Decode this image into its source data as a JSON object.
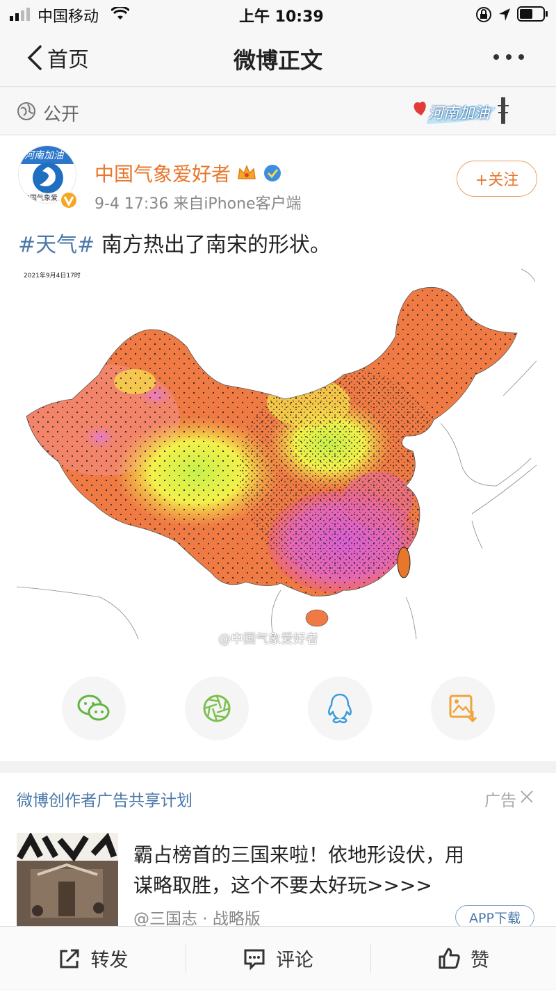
{
  "status_bar": {
    "carrier": "中国移动",
    "time": "上午 10:39"
  },
  "nav": {
    "back_label": "首页",
    "title": "微博正文",
    "more_icon": "more-dots-icon"
  },
  "visibility": {
    "label": "公开",
    "badge_text": "河南加油"
  },
  "post": {
    "author": "中国气象爱好者",
    "avatar_text": "河南加油",
    "avatar_caption": "中国气象爱",
    "meta": "9-4 17:36  来自iPhone客户端",
    "follow_label": "+关注",
    "hashtag": "#天气#",
    "text": " 南方热出了南宋的形状。",
    "map": {
      "timestamp": "2021年9月4日17时",
      "watermark": "@中国气象爱好者"
    }
  },
  "share": [
    {
      "name": "wechat-icon",
      "color": "#62b543"
    },
    {
      "name": "moments-icon",
      "color": "#7cc150"
    },
    {
      "name": "qq-icon",
      "color": "#3a9bdc"
    },
    {
      "name": "save-image-icon",
      "color": "#f2a23a"
    }
  ],
  "ad": {
    "header": "微博创作者广告共享计划",
    "tag": "广告",
    "close_icon": "close-icon",
    "headline_line1": "霸占榜首的三国来啦！依地形设伏，用",
    "headline_line2": "谋略取胜，这个不要太好玩>>>>",
    "source": "@三国志 · 战略版",
    "cta": "APP下载"
  },
  "toolbar": {
    "repost": "转发",
    "comment": "评论",
    "like": "赞"
  },
  "colors": {
    "link": "#4a78a8",
    "orange": "#e8762b",
    "like_gray": "#333333"
  }
}
